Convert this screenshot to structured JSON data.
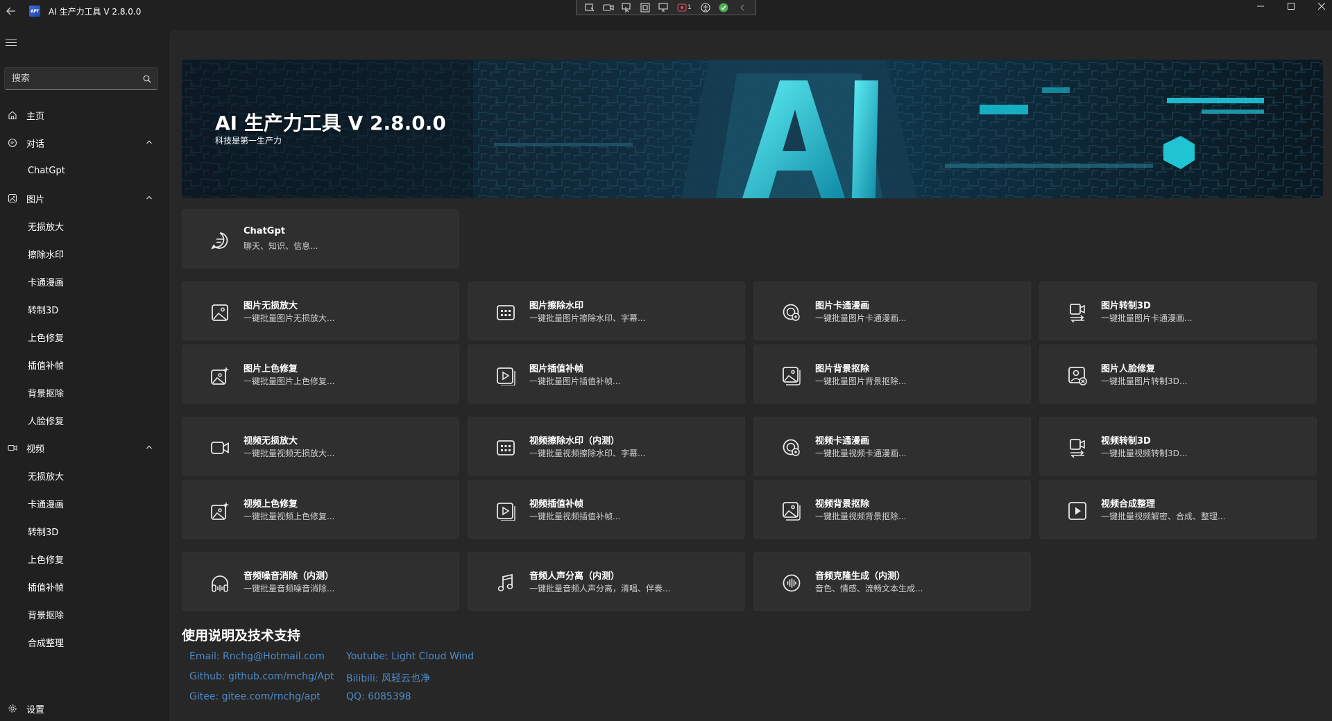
{
  "window": {
    "title": "AI 生产力工具 V 2.8.0.0",
    "logo_text": "APT"
  },
  "capture_toolbar": {
    "badge_count": "1"
  },
  "sidebar": {
    "search_placeholder": "搜索",
    "home": "主页",
    "dialog": {
      "label": "对话",
      "items": [
        "ChatGpt"
      ]
    },
    "image": {
      "label": "图片",
      "items": [
        "无损放大",
        "擦除水印",
        "卡通漫画",
        "转制3D",
        "上色修复",
        "插值补帧",
        "背景抠除",
        "人脸修复"
      ]
    },
    "video": {
      "label": "视频",
      "items": [
        "无损放大",
        "卡通漫画",
        "转制3D",
        "上色修复",
        "插值补帧",
        "背景抠除",
        "合成整理"
      ]
    },
    "settings": "设置"
  },
  "banner": {
    "title": "AI 生产力工具 V 2.8.0.0",
    "subtitle": "科技是第一生产力"
  },
  "cards": {
    "chat": {
      "title": "ChatGpt",
      "desc": "聊天、知识、信息...",
      "icon": "chat-bubble-icon"
    },
    "image_row1": [
      {
        "title": "图片无损放大",
        "desc": "一键批量图片无损放大...",
        "icon": "image-icon"
      },
      {
        "title": "图片擦除水印",
        "desc": "一键批量图片擦除水印、字幕...",
        "icon": "photo-grid-icon"
      },
      {
        "title": "图片卡通漫画",
        "desc": "一键批量图片卡通漫画...",
        "icon": "cartoon-icon"
      },
      {
        "title": "图片转制3D",
        "desc": "一键批量图片卡通漫画...",
        "icon": "convert-3d-icon"
      }
    ],
    "image_row2": [
      {
        "title": "图片上色修复",
        "desc": "一键批量图片上色修复...",
        "icon": "image-sparkle-icon"
      },
      {
        "title": "图片插值补帧",
        "desc": "一键批量图片插值补帧...",
        "icon": "play-frame-icon"
      },
      {
        "title": "图片背景抠除",
        "desc": "一键批量图片背景抠除...",
        "icon": "image-frame-icon"
      },
      {
        "title": "图片人脸修复",
        "desc": "一键批量图片转制3D...",
        "icon": "face-repair-icon"
      }
    ],
    "video_row1": [
      {
        "title": "视频无损放大",
        "desc": "一键批量视频无损放大...",
        "icon": "video-camera-icon"
      },
      {
        "title": "视频擦除水印（内测）",
        "desc": "一键批量视频擦除水印、字幕...",
        "icon": "photo-grid-icon"
      },
      {
        "title": "视频卡通漫画",
        "desc": "一键批量视频卡通漫画...",
        "icon": "cartoon-icon"
      },
      {
        "title": "视频转制3D",
        "desc": "一键批量视频转制3D...",
        "icon": "convert-3d-icon"
      }
    ],
    "video_row2": [
      {
        "title": "视频上色修复",
        "desc": "一键批量视频上色修复...",
        "icon": "image-sparkle-icon"
      },
      {
        "title": "视频插值补帧",
        "desc": "一键批量视频插值补帧...",
        "icon": "play-frame-icon"
      },
      {
        "title": "视频背景抠除",
        "desc": "一键批量视频背景抠除...",
        "icon": "image-frame-icon"
      },
      {
        "title": "视频合成整理",
        "desc": "一键批量视频解密、合成、整理...",
        "icon": "play-box-icon"
      }
    ],
    "audio_row": [
      {
        "title": "音频噪音消除（内测）",
        "desc": "一键批量音频噪音消除...",
        "icon": "headphones-icon"
      },
      {
        "title": "音频人声分离（内测）",
        "desc": "一键批量音频人声分离，清唱、伴奏...",
        "icon": "music-note-icon"
      },
      {
        "title": "音频克隆生成（内测）",
        "desc": "音色、情感、流畅文本生成...",
        "icon": "audio-wave-icon"
      }
    ]
  },
  "support": {
    "heading": "使用说明及技术支持",
    "email": "Email: Rnchg@Hotmail.com",
    "github": "Github: github.com/rnchg/Apt",
    "gitee": "Gitee: gitee.com/rnchg/apt",
    "youtube": "Youtube: Light Cloud Wind",
    "bilibili": "Bilibili: 风轻云也净",
    "qq": "QQ: 6085398"
  },
  "colors": {
    "background": "#202020",
    "content_bg": "#272727",
    "card_bg": "#2f2f2f",
    "link": "#4c8ac7",
    "banner_accent": "#19c4d8"
  }
}
